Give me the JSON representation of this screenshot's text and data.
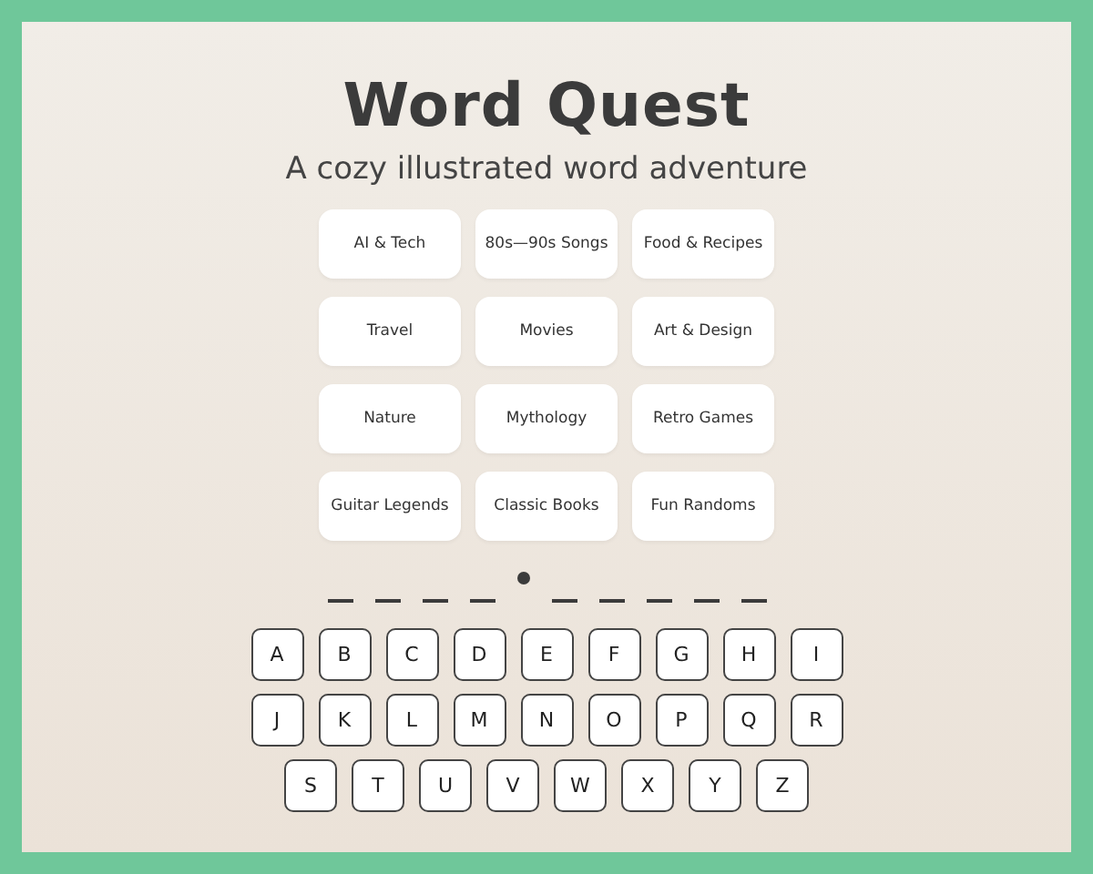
{
  "title": "Word Quest",
  "subtitle": "A cozy illustrated word adventure",
  "categories": [
    "AI & Tech",
    "80s—90s Songs",
    "Food & Recipes",
    "Travel",
    "Movies",
    "Art & Design",
    "Nature",
    "Mythology",
    "Retro Games",
    "Guitar Legends",
    "Classic Books",
    "Fun Randoms"
  ],
  "slots": [
    {
      "kind": "blank"
    },
    {
      "kind": "blank"
    },
    {
      "kind": "blank"
    },
    {
      "kind": "blank"
    },
    {
      "kind": "space"
    },
    {
      "kind": "blank"
    },
    {
      "kind": "blank"
    },
    {
      "kind": "blank"
    },
    {
      "kind": "blank"
    },
    {
      "kind": "blank"
    }
  ],
  "keyboard": [
    [
      "A",
      "B",
      "C",
      "D",
      "E",
      "F",
      "G",
      "H",
      "I"
    ],
    [
      "J",
      "K",
      "L",
      "M",
      "N",
      "O",
      "P",
      "Q",
      "R"
    ],
    [
      "S",
      "T",
      "U",
      "V",
      "W",
      "X",
      "Y",
      "Z"
    ]
  ]
}
